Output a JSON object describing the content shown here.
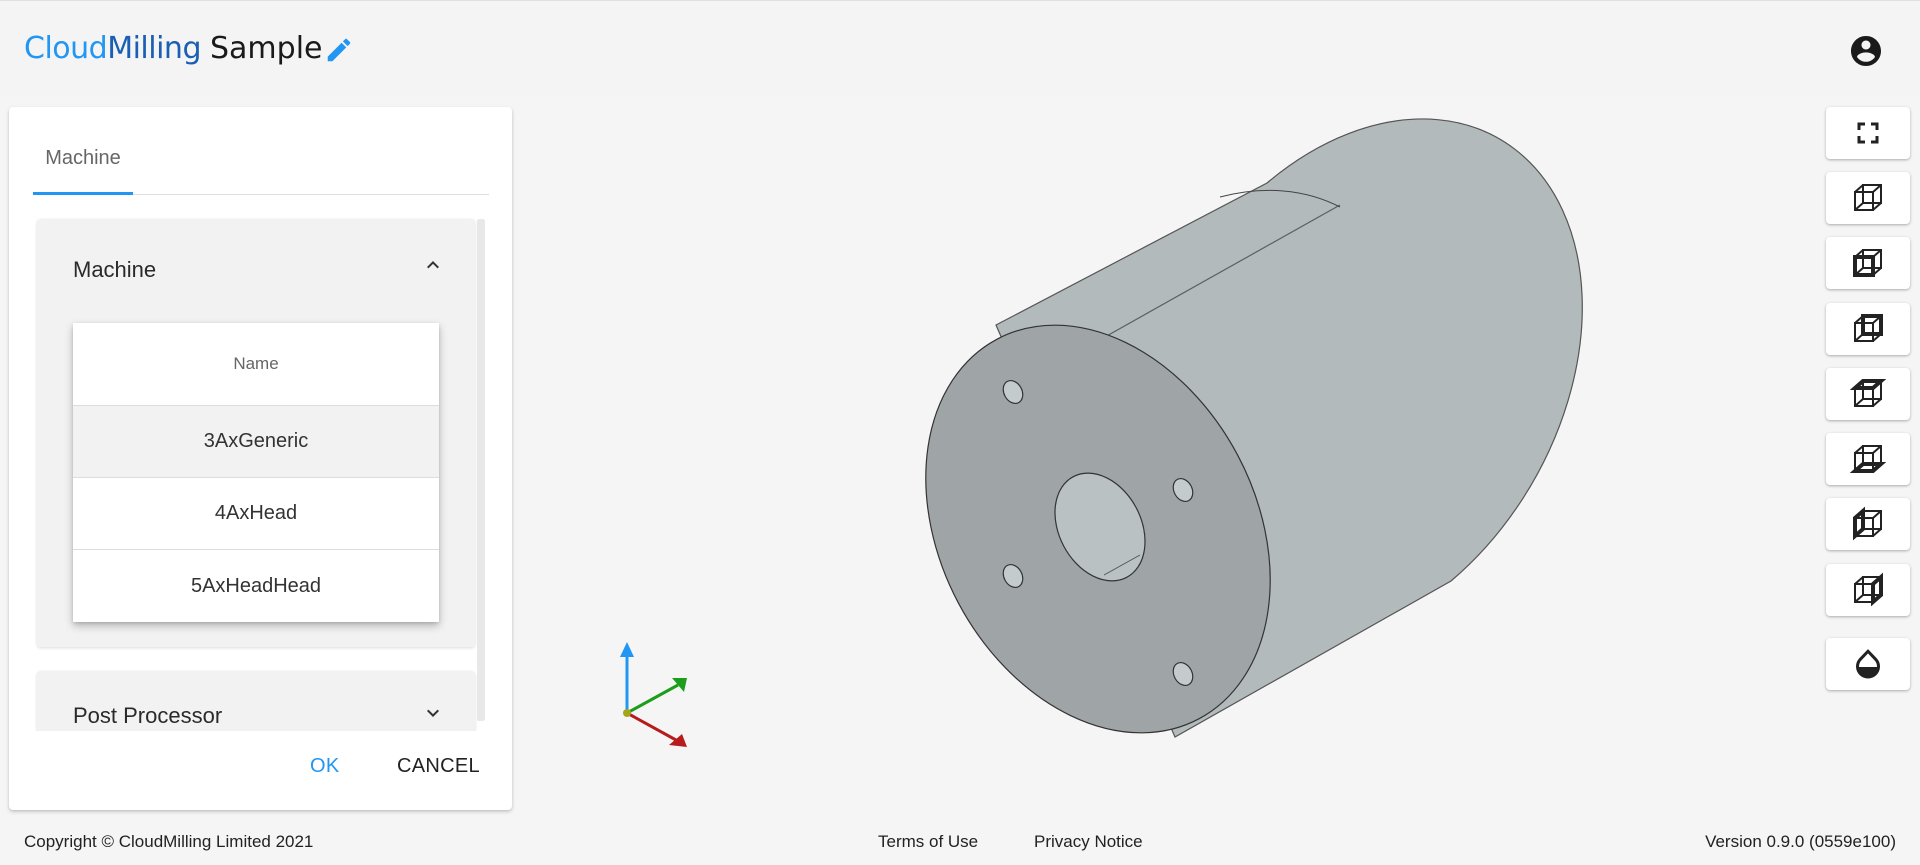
{
  "header": {
    "brand_part1": "Cloud",
    "brand_part2": "Milling",
    "project_title": "Sample",
    "icons": {
      "edit": "pencil-icon",
      "account": "account-circle-icon"
    }
  },
  "panel": {
    "tabs": [
      {
        "label": "Machine"
      }
    ],
    "machine_section": {
      "title": "Machine",
      "expanded": true,
      "table": {
        "header": "Name",
        "rows": [
          {
            "name": "3AxGeneric",
            "selected": true
          },
          {
            "name": "4AxHead",
            "selected": false
          },
          {
            "name": "5AxHeadHead",
            "selected": false
          }
        ]
      }
    },
    "post_section": {
      "title": "Post Processor",
      "expanded": false
    },
    "ok_label": "OK",
    "cancel_label": "CANCEL"
  },
  "toolbar": [
    {
      "name": "fullscreen-icon"
    },
    {
      "name": "iso-view-icon"
    },
    {
      "name": "front-view-icon"
    },
    {
      "name": "back-view-icon"
    },
    {
      "name": "top-view-icon"
    },
    {
      "name": "bottom-view-icon"
    },
    {
      "name": "left-view-icon"
    },
    {
      "name": "right-view-icon"
    },
    {
      "name": "material-drop-icon"
    }
  ],
  "colors": {
    "accent": "#2196f3",
    "brand_dark": "#1a5fb4",
    "axis_x": "#b71c1c",
    "axis_y": "#1b9e1b",
    "axis_z": "#2196f3",
    "part_face": "#9ea4a5",
    "part_side": "#b4bcbd"
  },
  "footer": {
    "copyright": "Copyright © CloudMilling Limited 2021",
    "terms": "Terms of Use",
    "privacy": "Privacy Notice",
    "version": "Version 0.9.0 (0559e100)"
  }
}
